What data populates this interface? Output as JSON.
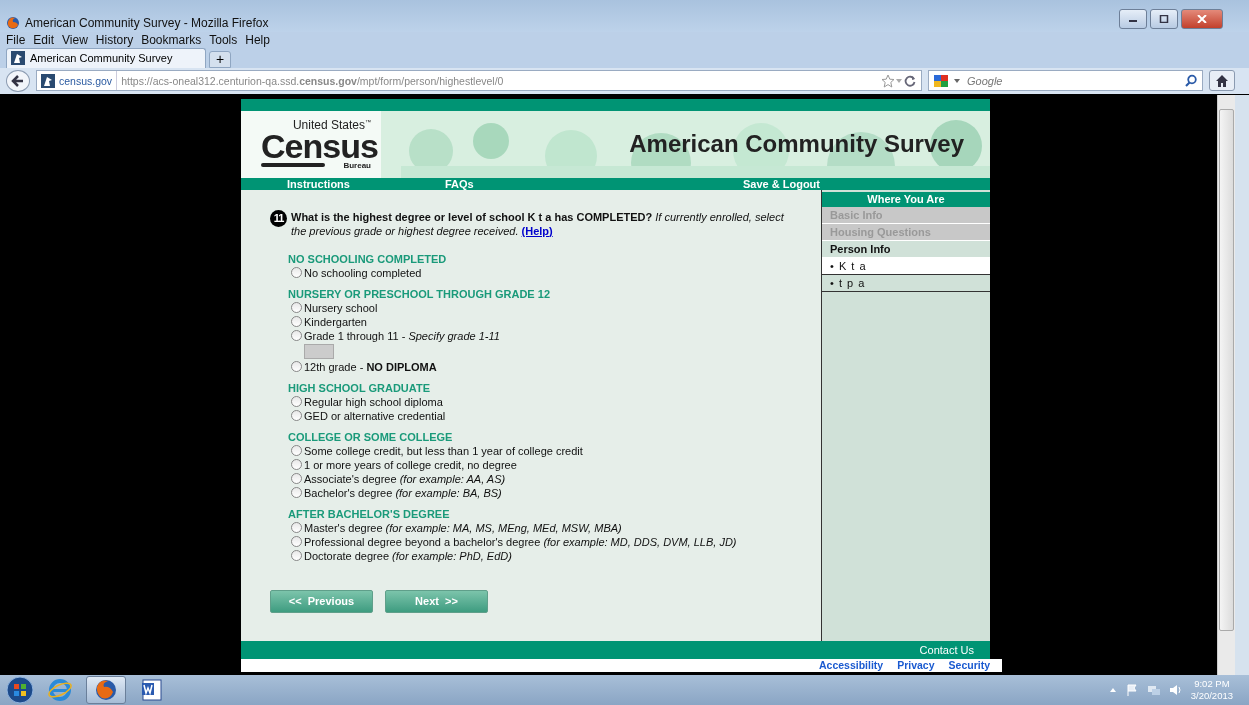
{
  "browser": {
    "title": "American Community Survey - Mozilla Firefox",
    "menu": [
      "File",
      "Edit",
      "View",
      "History",
      "Bookmarks",
      "Tools",
      "Help"
    ],
    "tabs": [
      {
        "label": "American Community Survey",
        "selected": true
      }
    ],
    "new_tab": "+",
    "site_identity": "census.gov",
    "url": "https://acs-oneal312.centurion-qa.ssd.**census.gov**/mpt/form/person/highestlevel/0",
    "search": {
      "placeholder": "Google"
    }
  },
  "header": {
    "logo_top": "United States",
    "logo_tm": "™",
    "logo_main": "Census",
    "logo_bottom": "Bureau",
    "title": "American Community Survey"
  },
  "nav": [
    "Instructions",
    "FAQs",
    "Save & Logout"
  ],
  "question": {
    "number": "11",
    "text": "**What is the highest degree or level of school K t a has COMPLETED?** *If currently enrolled, select the previous grade or highest degree received.*",
    "help": "(Help)"
  },
  "sections": [
    {
      "heading": "NO SCHOOLING COMPLETED",
      "options": [
        {
          "label": "No schooling completed",
          "selected": false
        }
      ]
    },
    {
      "heading": "NURSERY OR PRESCHOOL THROUGH GRADE 12",
      "options": [
        {
          "label": "Nursery school",
          "selected": false
        },
        {
          "label": "Kindergarten",
          "selected": false
        },
        {
          "label": "Grade 1 through 11 - *Specify grade 1-11*",
          "selected": false,
          "field": {
            "disabled": true
          }
        },
        {
          "label": "12th grade - **NO DIPLOMA**",
          "selected": false
        }
      ]
    },
    {
      "heading": "HIGH SCHOOL GRADUATE",
      "options": [
        {
          "label": "Regular high school diploma",
          "selected": false
        },
        {
          "label": "GED or alternative credential",
          "selected": false
        }
      ]
    },
    {
      "heading": "COLLEGE OR SOME COLLEGE",
      "options": [
        {
          "label": "Some college credit, but less than 1 year of college credit",
          "selected": false
        },
        {
          "label": "1 or more years of college credit, no degree",
          "selected": false
        },
        {
          "label": "Associate's degree *(for example: AA, AS)*",
          "selected": false
        },
        {
          "label": "Bachelor's degree *(for example: BA, BS)*",
          "selected": false
        }
      ]
    },
    {
      "heading": "AFTER BACHELOR'S DEGREE",
      "options": [
        {
          "label": "Master's degree *(for example: MA, MS, MEng, MEd, MSW, MBA)*",
          "selected": false
        },
        {
          "label": "Professional degree beyond a bachelor's degree *(for example: MD, DDS, DVM, LLB, JD)*",
          "selected": false
        },
        {
          "label": "Doctorate degree *(for example: PhD, EdD)*",
          "selected": false
        }
      ]
    }
  ],
  "buttons": [
    "<<  Previous",
    "Next  >>"
  ],
  "sidebar": {
    "heading": "Where You Are",
    "items": [
      {
        "kind": "step",
        "label": "Basic Info",
        "disabled": true
      },
      {
        "kind": "step",
        "label": "Housing Questions",
        "disabled": true
      },
      {
        "kind": "step",
        "label": "Person Info",
        "disabled": false
      },
      {
        "kind": "person",
        "label": "• K t a",
        "selected": true
      },
      {
        "kind": "person",
        "label": "• t p a",
        "selected": false
      }
    ]
  },
  "footer": {
    "contact": "Contact Us",
    "links": [
      "Accessibility",
      "Privacy",
      "Security"
    ]
  },
  "taskbar": {
    "apps": [
      {
        "kind": "ie",
        "selected": false
      },
      {
        "kind": "firefox",
        "selected": true
      },
      {
        "kind": "word",
        "selected": false
      }
    ],
    "time": "9:02 PM",
    "date": "3/20/2013"
  }
}
